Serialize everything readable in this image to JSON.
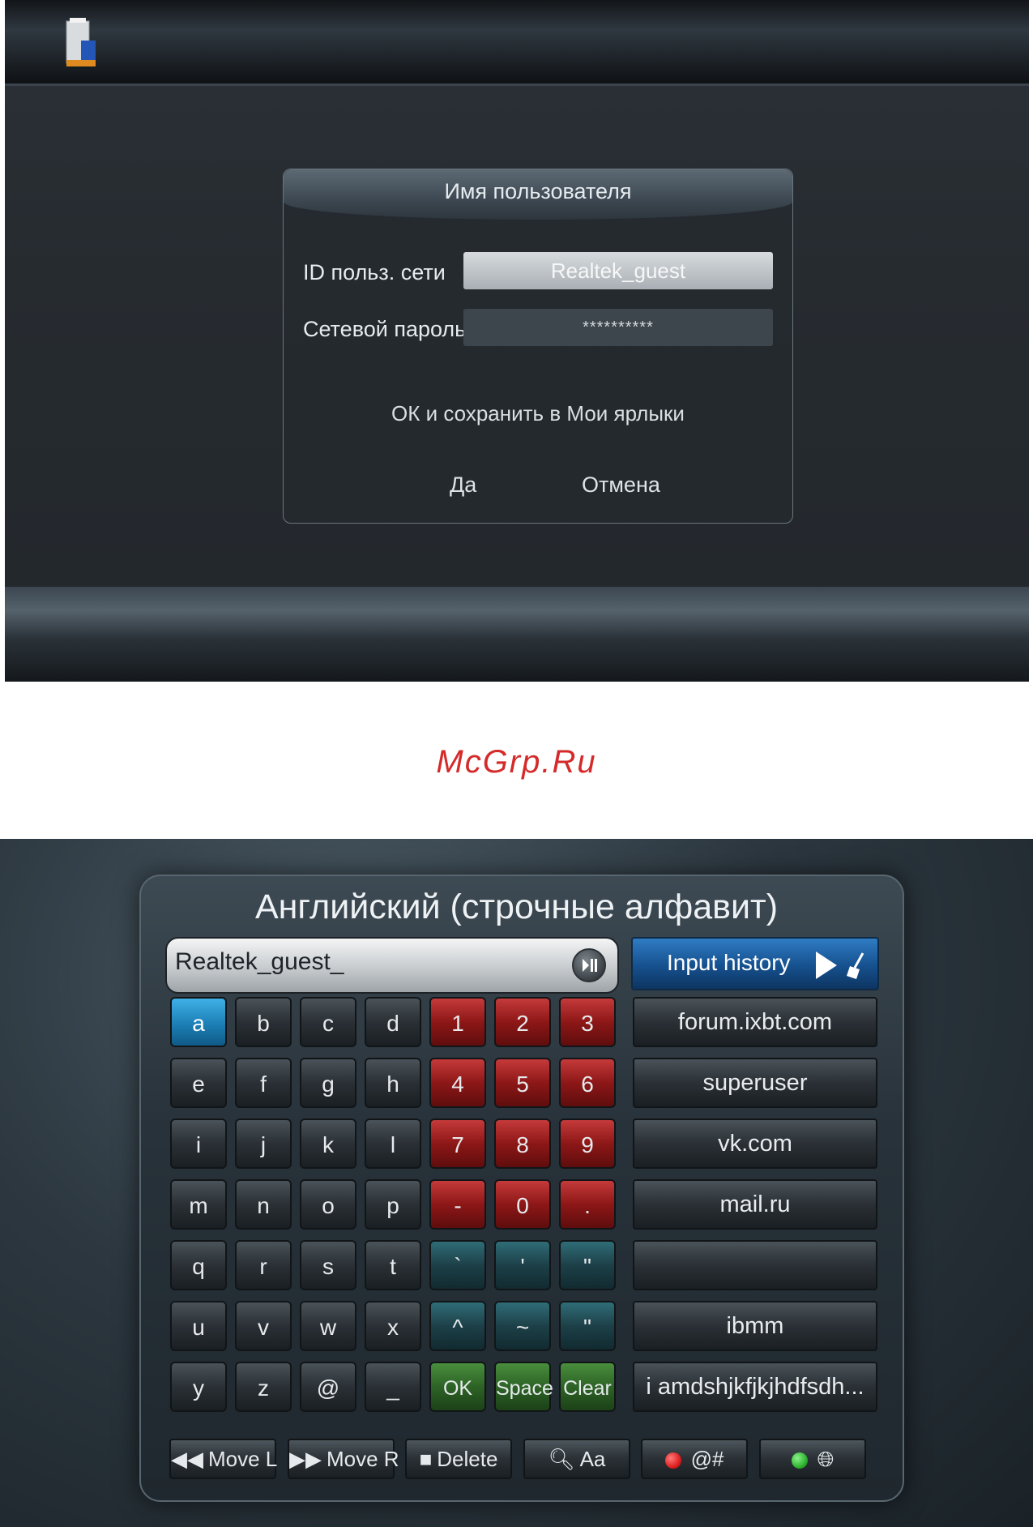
{
  "dialog": {
    "title": "Имя пользователя",
    "id_label": "ID польз. сети",
    "id_value": "Realtek_guest",
    "password_label": "Сетевой пароль",
    "password_value": "**********",
    "save_label": "ОК и сохранить в Мои ярлыки",
    "yes_label": "Да",
    "cancel_label": "Отмена"
  },
  "watermark": "McGrp.Ru",
  "keyboard": {
    "title": "Английский (строчные алфавит)",
    "input_value": "Realtek_guest_",
    "selected_key": "a",
    "rows": [
      [
        "a",
        "b",
        "c",
        "d",
        "1",
        "2",
        "3"
      ],
      [
        "e",
        "f",
        "g",
        "h",
        "4",
        "5",
        "6"
      ],
      [
        "i",
        "j",
        "k",
        "l",
        "7",
        "8",
        "9"
      ],
      [
        "m",
        "n",
        "o",
        "p",
        "-",
        "0",
        "."
      ],
      [
        "q",
        "r",
        "s",
        "t",
        "`",
        "'",
        "\""
      ],
      [
        "u",
        "v",
        "w",
        "x",
        "^",
        "~",
        "\""
      ],
      [
        "y",
        "z",
        "@",
        "_",
        "OK",
        "Space",
        "Clear"
      ]
    ]
  },
  "history": {
    "title": "Input history",
    "items": [
      "forum.ixbt.com",
      "superuser",
      "vk.com",
      "mail.ru",
      "",
      "ibmm",
      "i amdshjkfjkjhdfsdh..."
    ]
  },
  "footer": {
    "move_left": "Move L",
    "move_right": "Move R",
    "delete": "Delete",
    "case": "Aa",
    "symbols": "@#"
  },
  "colors": {
    "selected_key": "#1c7fb6",
    "numeric_keys": "#8d1717",
    "symbol_keys": "#1d4048",
    "action_keys": "#2d6326",
    "red_button": "#e02020",
    "green_button": "#2fb52f"
  }
}
